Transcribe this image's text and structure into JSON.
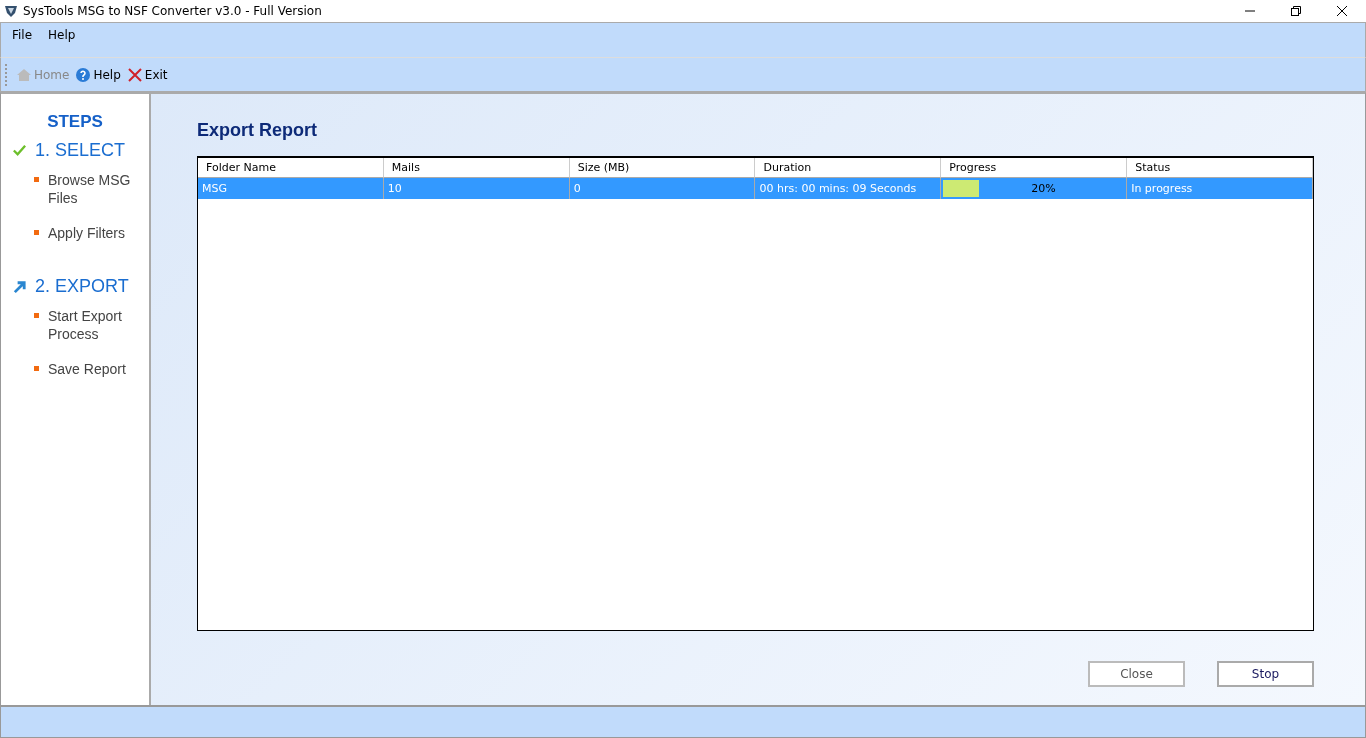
{
  "window": {
    "title": "SysTools MSG to NSF Converter v3.0 - Full Version"
  },
  "menu": [
    "File",
    "Help"
  ],
  "toolbar": [
    {
      "label": "Home",
      "kind": "home",
      "disabled": true
    },
    {
      "label": "Help",
      "kind": "help",
      "disabled": false
    },
    {
      "label": "Exit",
      "kind": "exit",
      "disabled": false
    }
  ],
  "steps": {
    "title": "STEPS",
    "groups": [
      {
        "label": "1. SELECT",
        "kind": "done",
        "items": [
          "Browse MSG Files",
          "Apply Filters"
        ]
      },
      {
        "label": "2. EXPORT",
        "kind": "current",
        "items": [
          "Start Export Process",
          "Save Report"
        ]
      }
    ]
  },
  "report": {
    "title": "Export Report",
    "columns": [
      "Folder Name",
      "Mails",
      "Size (MB)",
      "Duration",
      "Progress",
      "Status"
    ],
    "rows": [
      {
        "folder": "MSG",
        "mails": "10",
        "size": "0",
        "duration": "00 hrs: 00 mins: 09 Seconds",
        "level": 0.2,
        "progress": "20%",
        "status": "In progress",
        "selected": true
      }
    ]
  },
  "buttons": [
    {
      "label": "Close",
      "disabled": true
    },
    {
      "label": "Stop",
      "disabled": false
    }
  ]
}
